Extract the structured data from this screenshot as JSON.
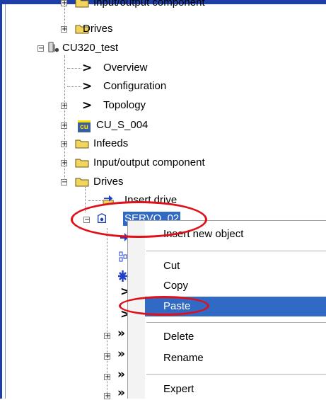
{
  "tree": {
    "items": [
      {
        "label": "Input/output component"
      },
      {
        "label": "Drives"
      },
      {
        "label": "CU320_test"
      },
      {
        "label": "Overview"
      },
      {
        "label": "Configuration"
      },
      {
        "label": "Topology"
      },
      {
        "label": "CU_S_004"
      },
      {
        "label": "Infeeds"
      },
      {
        "label": "Input/output component"
      },
      {
        "label": "Drives"
      },
      {
        "label": "Insert drive"
      },
      {
        "label": "SERVO_02"
      }
    ],
    "expander_plus": "+",
    "expander_minus": "−",
    "cu_badge": "cu"
  },
  "context_menu": {
    "items": [
      {
        "label": "Insert new object"
      },
      {
        "label": "Cut"
      },
      {
        "label": "Copy"
      },
      {
        "label": "Paste",
        "selected": true
      },
      {
        "label": "Delete"
      },
      {
        "label": "Rename"
      },
      {
        "label": "Expert"
      }
    ]
  },
  "colors": {
    "selection": "#316ac5",
    "annotation": "#e0101a",
    "folder": "#f2d55c"
  }
}
